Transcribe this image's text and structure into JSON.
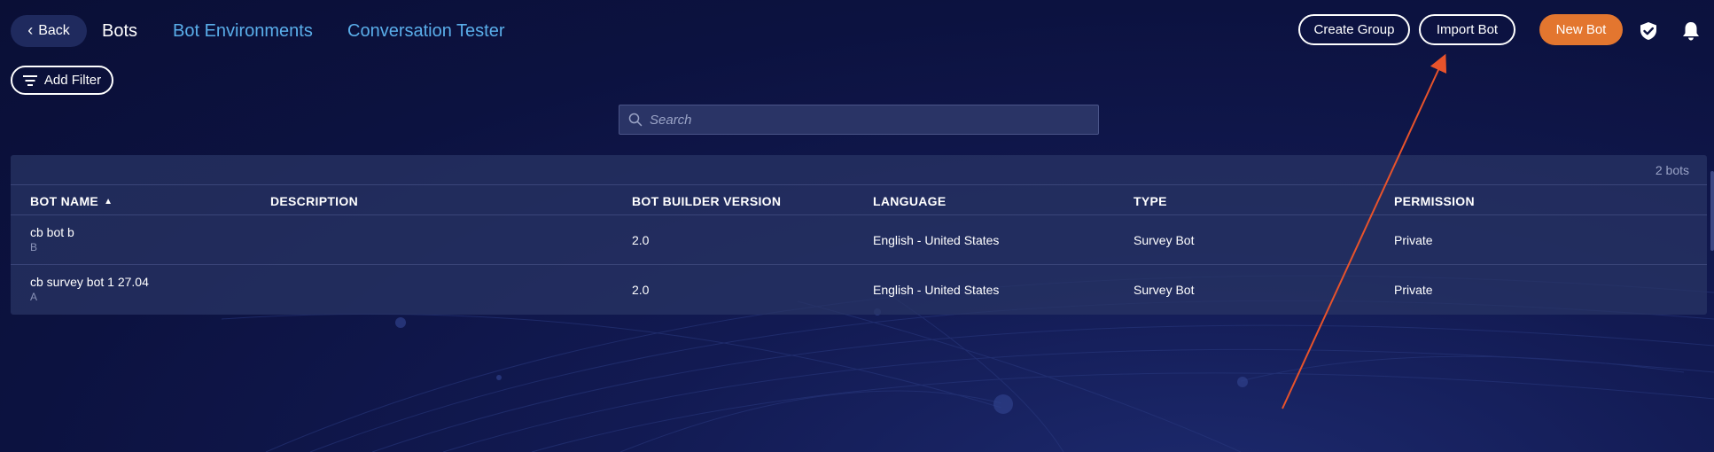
{
  "header": {
    "back_label": "Back",
    "title": "Bots",
    "tabs": [
      "Bot Environments",
      "Conversation Tester"
    ]
  },
  "actions": {
    "create_group": "Create Group",
    "import_bot": "Import Bot",
    "new_bot": "New Bot"
  },
  "filter": {
    "add_filter_label": "Add Filter"
  },
  "search": {
    "placeholder": "Search",
    "value": ""
  },
  "table": {
    "count_label": "2 bots",
    "sort_column": "BOT NAME",
    "sort_direction": "ascending",
    "columns": [
      "BOT NAME",
      "DESCRIPTION",
      "BOT BUILDER VERSION",
      "LANGUAGE",
      "TYPE",
      "PERMISSION"
    ],
    "rows": [
      {
        "name": "cb bot b",
        "sub": "B",
        "description": "",
        "version": "2.0",
        "language": "English - United States",
        "type": "Survey Bot",
        "permission": "Private"
      },
      {
        "name": "cb survey bot 1 27.04",
        "sub": "A",
        "description": "",
        "version": "2.0",
        "language": "English - United States",
        "type": "Survey Bot",
        "permission": "Private"
      }
    ]
  },
  "icons": {
    "back": "chevron-left-icon",
    "filter": "filter-icon",
    "search": "search-icon",
    "shield": "shield-icon",
    "bell": "bell-icon"
  },
  "colors": {
    "accent": "#e3762f",
    "link": "#5aaeea",
    "annotation_arrow": "#e8532b"
  }
}
